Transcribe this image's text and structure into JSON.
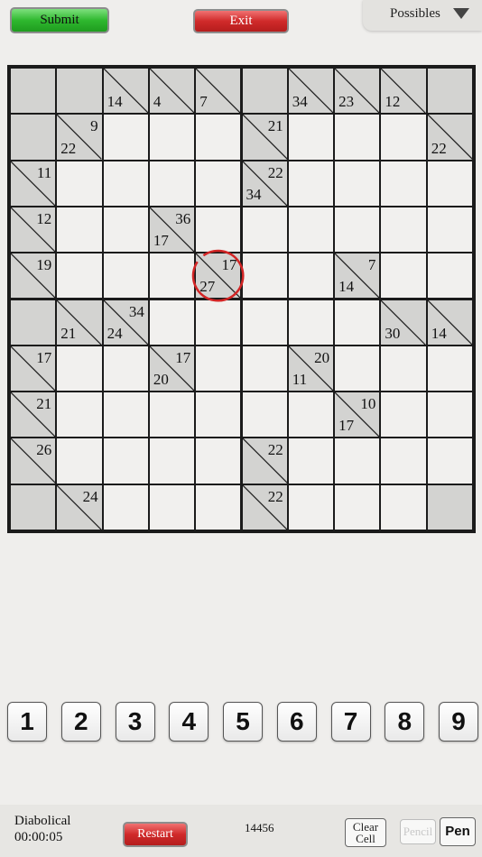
{
  "header": {
    "submit_label": "Submit",
    "exit_label": "Exit",
    "possibles_label": "Possibles",
    "possibles_icon": "triangle-down-icon"
  },
  "board": {
    "size": 10,
    "selected_cell": [
      4,
      4
    ],
    "selected_color": "#d32525",
    "cells": [
      [
        {
          "t": "b"
        },
        {
          "t": "b"
        },
        {
          "t": "c",
          "d": "14"
        },
        {
          "t": "c",
          "d": "4"
        },
        {
          "t": "c",
          "d": "7"
        },
        {
          "t": "b"
        },
        {
          "t": "c",
          "d": "34"
        },
        {
          "t": "c",
          "d": "23"
        },
        {
          "t": "c",
          "d": "12"
        },
        {
          "t": "b"
        }
      ],
      [
        {
          "t": "b"
        },
        {
          "t": "c",
          "r": "9",
          "d": "22"
        },
        {
          "t": "w"
        },
        {
          "t": "w"
        },
        {
          "t": "w"
        },
        {
          "t": "c",
          "r": "21"
        },
        {
          "t": "w"
        },
        {
          "t": "w"
        },
        {
          "t": "w"
        },
        {
          "t": "c",
          "d": "22"
        }
      ],
      [
        {
          "t": "c",
          "r": "11"
        },
        {
          "t": "w"
        },
        {
          "t": "w"
        },
        {
          "t": "w"
        },
        {
          "t": "w"
        },
        {
          "t": "c",
          "r": "22",
          "d": "34"
        },
        {
          "t": "w"
        },
        {
          "t": "w"
        },
        {
          "t": "w"
        },
        {
          "t": "w"
        }
      ],
      [
        {
          "t": "c",
          "r": "12"
        },
        {
          "t": "w"
        },
        {
          "t": "w"
        },
        {
          "t": "c",
          "r": "36",
          "d": "17"
        },
        {
          "t": "w"
        },
        {
          "t": "w"
        },
        {
          "t": "w"
        },
        {
          "t": "w"
        },
        {
          "t": "w"
        },
        {
          "t": "w"
        }
      ],
      [
        {
          "t": "c",
          "r": "19"
        },
        {
          "t": "w"
        },
        {
          "t": "w"
        },
        {
          "t": "w"
        },
        {
          "t": "c",
          "r": "17",
          "d": "27"
        },
        {
          "t": "w"
        },
        {
          "t": "w"
        },
        {
          "t": "c",
          "r": "7",
          "d": "14"
        },
        {
          "t": "w"
        },
        {
          "t": "w"
        }
      ],
      [
        {
          "t": "b"
        },
        {
          "t": "c",
          "d": "21"
        },
        {
          "t": "c",
          "r": "34",
          "d": "24"
        },
        {
          "t": "w"
        },
        {
          "t": "w"
        },
        {
          "t": "w"
        },
        {
          "t": "w"
        },
        {
          "t": "w"
        },
        {
          "t": "c",
          "d": "30"
        },
        {
          "t": "c",
          "d": "14"
        }
      ],
      [
        {
          "t": "c",
          "r": "17"
        },
        {
          "t": "w"
        },
        {
          "t": "w"
        },
        {
          "t": "c",
          "r": "17",
          "d": "20"
        },
        {
          "t": "w"
        },
        {
          "t": "w"
        },
        {
          "t": "c",
          "r": "20",
          "d": "11"
        },
        {
          "t": "w"
        },
        {
          "t": "w"
        },
        {
          "t": "w"
        }
      ],
      [
        {
          "t": "c",
          "r": "21"
        },
        {
          "t": "w"
        },
        {
          "t": "w"
        },
        {
          "t": "w"
        },
        {
          "t": "w"
        },
        {
          "t": "w"
        },
        {
          "t": "w"
        },
        {
          "t": "c",
          "r": "10",
          "d": "17"
        },
        {
          "t": "w"
        },
        {
          "t": "w"
        }
      ],
      [
        {
          "t": "c",
          "r": "26"
        },
        {
          "t": "w"
        },
        {
          "t": "w"
        },
        {
          "t": "w"
        },
        {
          "t": "w"
        },
        {
          "t": "c",
          "r": "22"
        },
        {
          "t": "w"
        },
        {
          "t": "w"
        },
        {
          "t": "w"
        },
        {
          "t": "w"
        }
      ],
      [
        {
          "t": "b"
        },
        {
          "t": "c",
          "r": "24"
        },
        {
          "t": "w"
        },
        {
          "t": "w"
        },
        {
          "t": "w"
        },
        {
          "t": "c",
          "r": "22"
        },
        {
          "t": "w"
        },
        {
          "t": "w"
        },
        {
          "t": "w"
        },
        {
          "t": "b"
        }
      ]
    ]
  },
  "keypad": [
    "1",
    "2",
    "3",
    "4",
    "5",
    "6",
    "7",
    "8",
    "9"
  ],
  "footer": {
    "difficulty": "Diabolical",
    "timer": "00:00:05",
    "restart_label": "Restart",
    "puzzle_id": "14456",
    "clear_cell_label_line1": "Clear",
    "clear_cell_label_line2": "Cell",
    "pencil_label": "Pencil",
    "pen_label": "Pen"
  }
}
